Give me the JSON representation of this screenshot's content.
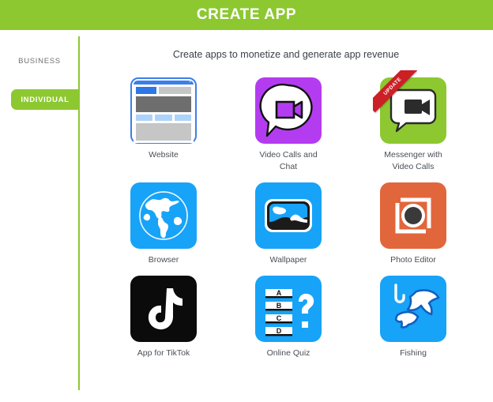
{
  "header": {
    "title": "CREATE APP"
  },
  "sidebar": {
    "items": [
      {
        "label": "BUSINESS",
        "active": false
      },
      {
        "label": "INDIVIDUAL",
        "active": true
      }
    ]
  },
  "main": {
    "subtitle": "Create apps to monetize and generate app revenue",
    "apps": [
      {
        "label": "Website",
        "icon": "website-icon",
        "badge": null
      },
      {
        "label": "Video Calls and Chat",
        "icon": "video-chat-icon",
        "badge": null
      },
      {
        "label": "Messenger with Video Calls",
        "icon": "messenger-icon",
        "badge": "UPDATE"
      },
      {
        "label": "Browser",
        "icon": "globe-icon",
        "badge": null
      },
      {
        "label": "Wallpaper",
        "icon": "landscape-icon",
        "badge": null
      },
      {
        "label": "Photo Editor",
        "icon": "camera-crop-icon",
        "badge": null
      },
      {
        "label": "App for TikTok",
        "icon": "tiktok-note-icon",
        "badge": null
      },
      {
        "label": "Online Quiz",
        "icon": "quiz-abcd-icon",
        "badge": null
      },
      {
        "label": "Fishing",
        "icon": "fish-hook-icon",
        "badge": null
      }
    ]
  },
  "colors": {
    "brand_green": "#8DC831",
    "purple": "#B43CF0",
    "blue": "#17A3F7",
    "orange": "#E2663B",
    "black": "#0B0B0B",
    "ribbon_red": "#CC1F26",
    "browser_blue": "#3C7FE8"
  }
}
